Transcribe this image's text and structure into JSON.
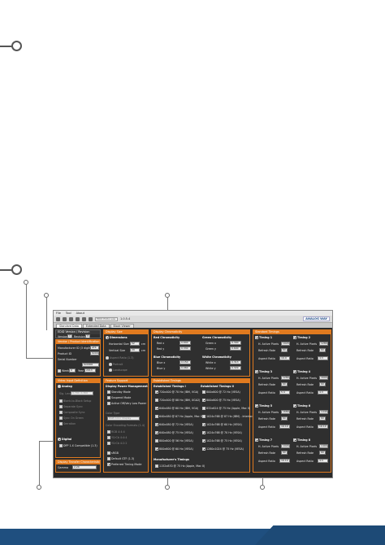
{
  "menu": {
    "file": "File",
    "tool": "Tool",
    "about": "About"
  },
  "toolbar": {
    "field": "EDID Editor.exe",
    "version": "1.0.5.4",
    "logo": "ANALOG WAY"
  },
  "tabs": [
    "Standard Data",
    "Extended Data",
    "Block Viewer"
  ],
  "edid_version": {
    "title": "EDID Version / Revision",
    "version_label": "Version",
    "version_value": "1",
    "revision_label": "Revision",
    "revision_value": "3"
  },
  "vendor": {
    "title": "Vendor / Product Identification",
    "manufacturer_label": "Manufacturer ID (3 digits)",
    "manufacturer_value": "ATK",
    "product_label": "Product ID",
    "product_value": "0x0A0C",
    "serial_label": "Serial Number",
    "serial_value": "0x0000",
    "manufacture_week_label": "Week",
    "manufacture_week_value": "0",
    "year_label": "Year",
    "year_value": "2013"
  },
  "video_input": {
    "title": "Video Input Definition",
    "analog_label": "Analog",
    "signal_label": "Sig. Level",
    "signal_value": "0.700, 0.300",
    "opts": [
      "Blank-to-Black Setup",
      "Separate Sync",
      "Composite Sync",
      "Sync On Green",
      "Serration"
    ],
    "digital_label": "Digital",
    "dfp_label": "DFP 1.X Compatible (1.3)"
  },
  "display_size": {
    "title": "Display Size",
    "dimensions_label": "Dimensions",
    "horizontal_label": "Horizontal Size",
    "horizontal_value": "52",
    "vertical_label": "Vertical Size",
    "vertical_value": "29",
    "cm_label": "cm",
    "aspect_label": "Aspect Ratio (1.3)",
    "portrait_label": "Portrait",
    "landscape_label": "Landscape"
  },
  "feature_support": {
    "title": "Feature Support",
    "dpm_title": "Display Power Management",
    "dpm": [
      "Standby Mode",
      "Suspend Mode",
      "Active Off/Very Low Power"
    ],
    "color_type_label": "Color Type",
    "color_type_value": "RGB Color Display",
    "color_enc_label": "Color Encoding Formats (1.4)",
    "color_enc": [
      "RGB 4:4:4",
      "YCrCb 4:4:4",
      "YCrCb 4:2:2"
    ],
    "srgb": "sRGB",
    "default_gtf": "Default GTF (1.3)",
    "preferred": "Preferred Timing Mode"
  },
  "gamma": {
    "title": "Display Transfer Characteristics",
    "label": "Gamma",
    "value": "2.20"
  },
  "chroma": {
    "title": "Display Chromaticity",
    "red_title": "Red Chromaticity",
    "green_title": "Green Chromaticity",
    "blue_title": "Blue Chromaticity",
    "white_title": "White Chromaticity",
    "redx": "Red x",
    "redx_v": "0.640",
    "redy": "Red y",
    "redy_v": "0.330",
    "greenx": "Green x",
    "greenx_v": "0.300",
    "greeny": "Green y",
    "greeny_v": "0.600",
    "bluex": "Blue x",
    "bluex_v": "0.150",
    "bluey": "Blue y",
    "bluey_v": "0.060",
    "whitex": "White x",
    "whitex_v": "0.313",
    "whitey": "White y",
    "whitey_v": "0.329"
  },
  "established": {
    "title": "Established Timings",
    "col1_title": "Established Timings I",
    "col2_title": "Established Timings II",
    "col1": [
      "720x400 @ 70 Hz (IBM, VGA)",
      "720x400 @ 88 Hz (IBM, XGA2)",
      "640x480 @ 60 Hz (IBM, VGA)",
      "640x480 @ 67 Hz (Apple, Mac II)",
      "640x480 @ 72 Hz (VESA)",
      "640x480 @ 75 Hz (VESA)",
      "800x600 @ 56 Hz (VESA)",
      "800x600 @ 60 Hz (VESA)"
    ],
    "col2": [
      "800x600 @ 72 Hz (VESA)",
      "800x600 @ 75 Hz (VESA)",
      "832x624 @ 75 Hz (Apple, Mac II)",
      "1024x768 @ 87 Hz (IBM) - Interlaced",
      "1024x768 @ 60 Hz (VESA)",
      "1024x768 @ 70 Hz (VESA)",
      "1024x768 @ 75 Hz (VESA)",
      "1280x1024 @ 75 Hz (VESA)"
    ],
    "mfr_title": "Manufacturer's Timings",
    "mfr_item": "1152x870 @ 75 Hz (Apple, Mac II)"
  },
  "standard": {
    "title": "Standard Timings",
    "timings": [
      {
        "name": "Timing 1",
        "h": "1920",
        "r": "60",
        "a": "16:9"
      },
      {
        "name": "Timing 2",
        "h": "1280",
        "r": "60",
        "a": "4:3"
      },
      {
        "name": "Timing 3",
        "h": "1280",
        "r": "60",
        "a": "5:4"
      },
      {
        "name": "Timing 4",
        "h": "1600",
        "r": "60",
        "a": "4:3"
      },
      {
        "name": "Timing 5",
        "h": "1680",
        "r": "60",
        "a": "16:10"
      },
      {
        "name": "Timing 6",
        "h": "1440",
        "r": "60",
        "a": "16:10"
      },
      {
        "name": "Timing 7",
        "h": "1920",
        "r": "60",
        "a": "16:10"
      },
      {
        "name": "Timing 8",
        "h": "1400",
        "r": "60",
        "a": "4:3"
      }
    ],
    "h_label": "H. Active Pixels",
    "r_label": "Refresh Rate",
    "a_label": "Aspect Ratio"
  }
}
